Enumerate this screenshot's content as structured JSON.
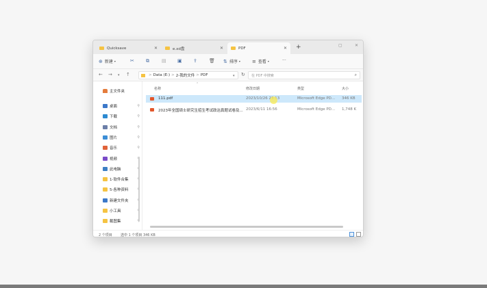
{
  "tabs": [
    {
      "label": "Quicksave"
    },
    {
      "label": "e.xd盘"
    },
    {
      "label": "PDF"
    }
  ],
  "new_tab": "+",
  "window_controls": {
    "minimize": "—",
    "maximize": "▢",
    "close": "✕"
  },
  "commands": {
    "new": "新建",
    "sort": "排序",
    "view": "查看",
    "more": "···"
  },
  "address": {
    "root": "Data (E:)",
    "folder": "2-我的文件",
    "current": "PDF",
    "separator": ">"
  },
  "search": {
    "placeholder": "在 PDF 中搜索"
  },
  "sidebar": {
    "home": "主文件夹",
    "items": [
      {
        "label": "桌面",
        "color": "#3b78c9"
      },
      {
        "label": "下载",
        "color": "#2d8ad1"
      },
      {
        "label": "文档",
        "color": "#6c7fa8"
      },
      {
        "label": "图片",
        "color": "#3c8ed6"
      },
      {
        "label": "音乐",
        "color": "#e0633a"
      },
      {
        "label": "视频",
        "color": "#7a4bc9"
      },
      {
        "label": "此电脑",
        "color": "#3d7fc4"
      },
      {
        "label": "1-软件合集",
        "color": "#f5c342"
      },
      {
        "label": "5-各种资料",
        "color": "#f5c342"
      },
      {
        "label": "新建文件夹",
        "color": "#3b78c9"
      },
      {
        "label": "小工具",
        "color": "#f5c342"
      },
      {
        "label": "截图集",
        "color": "#f5c342"
      }
    ]
  },
  "columns": {
    "name": "名称",
    "modified": "修改日期",
    "type": "类型",
    "size": "大小"
  },
  "files": [
    {
      "name": "111.pdf",
      "modified": "2023/10/26 23:13",
      "type": "Microsoft Edge PD...",
      "size": "346 KB"
    },
    {
      "name": "2023年全国硕士研究生招生考试政治真题试卷及...",
      "modified": "2023/6/11 16:56",
      "type": "Microsoft Edge PD...",
      "size": "1,748 K"
    }
  ],
  "status": {
    "count": "2 个项目",
    "selected": "选中 1 个项目  346 KB"
  }
}
